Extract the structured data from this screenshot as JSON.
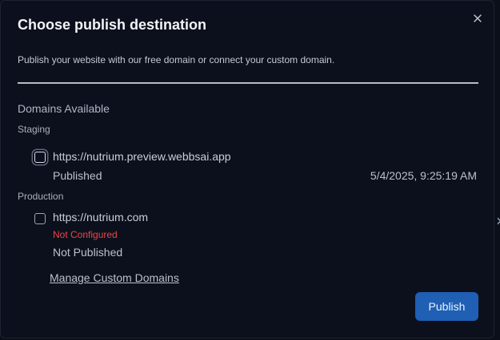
{
  "dialog": {
    "title": "Choose publish destination",
    "subtitle": "Publish your website with our free domain or connect your custom domain.",
    "close_icon": "close-icon",
    "section_heading": "Domains Available"
  },
  "staging": {
    "label": "Staging",
    "domain": {
      "url": "https://nutrium.preview.webbsai.app",
      "status": "Published",
      "timestamp": "5/4/2025, 9:25:19 AM",
      "checked": false
    }
  },
  "production": {
    "label": "Production",
    "domain": {
      "url": "https://nutrium.com",
      "warning": "Not Configured",
      "status": "Not Published",
      "checked": false
    }
  },
  "manage_link": "Manage Custom Domains",
  "publish_button": "Publish",
  "colors": {
    "accent": "#1f5fb4",
    "warning": "#ef4444",
    "background": "#0c101c"
  }
}
